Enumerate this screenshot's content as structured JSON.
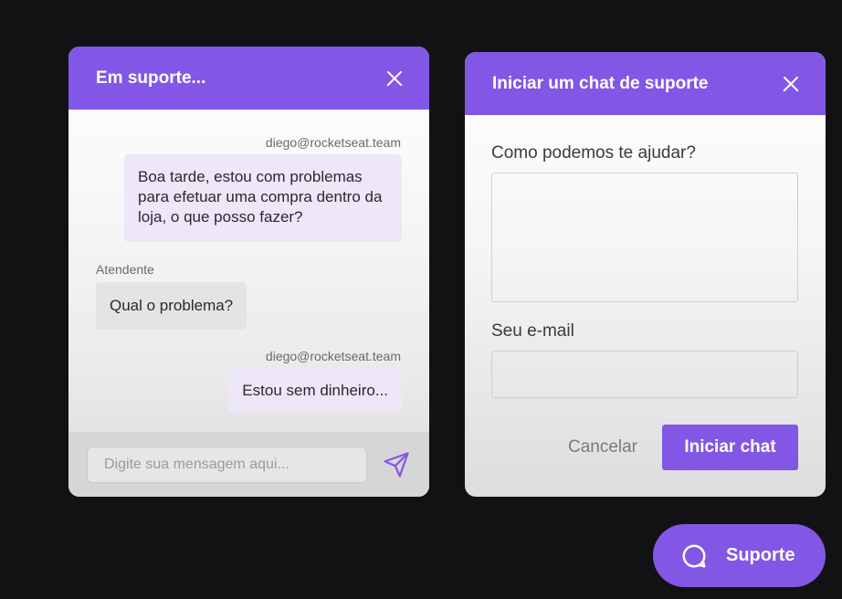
{
  "chat": {
    "title": "Em suporte...",
    "messages": [
      {
        "sender": "diego@rocketseat.team",
        "lines": [
          "Boa tarde, estou com problemas",
          "para efetuar uma compra dentro da",
          "loja, o que posso fazer?"
        ]
      },
      {
        "sender": "Atendente",
        "text": "Qual o problema?"
      },
      {
        "sender": "diego@rocketseat.team",
        "text": "Estou sem dinheiro..."
      }
    ],
    "input_placeholder": "Digite sua mensagem aqui..."
  },
  "form": {
    "title": "Iniciar um chat de suporte",
    "question_label": "Como podemos te ajudar?",
    "email_label": "Seu e-mail",
    "cancel_label": "Cancelar",
    "submit_label": "Iniciar chat"
  },
  "support_button": {
    "label": "Suporte"
  },
  "colors": {
    "accent": "#8257e5",
    "background": "#121214"
  }
}
